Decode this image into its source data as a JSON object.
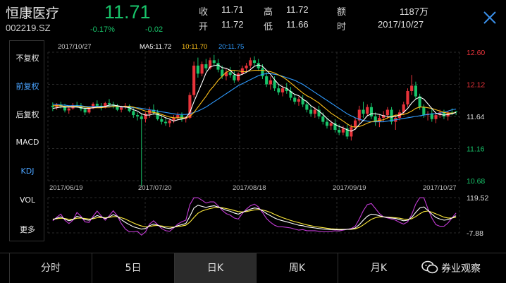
{
  "stock": {
    "name": "恒康医疗",
    "code": "002219.SZ",
    "price": "11.71",
    "change_pct": "-0.17%",
    "change_abs": "-0.02"
  },
  "quote": {
    "close_label": "收",
    "close_value": "11.71",
    "open_label": "开",
    "open_value": "11.72",
    "high_label": "高",
    "high_value": "11.72",
    "low_label": "低",
    "low_value": "11.66",
    "amount_label": "额",
    "amount_value": "1187万",
    "time_label": "时",
    "time_value": "2017/10/27"
  },
  "sidebar": {
    "items": [
      {
        "label": "不复权",
        "active": false
      },
      {
        "label": "前复权",
        "active": true
      },
      {
        "label": "后复权",
        "active": false
      },
      {
        "label": "MACD",
        "active": false
      },
      {
        "label": "KDJ",
        "active": true
      },
      {
        "label": "VOL",
        "active": false
      },
      {
        "label": "更多",
        "active": false
      }
    ]
  },
  "ma_legend": {
    "date": "2017/10/27",
    "ma5": "MA5:11.72",
    "ma10": "10:11.70",
    "ma20": "20:11.75"
  },
  "tabs": [
    {
      "label": "分时",
      "active": false
    },
    {
      "label": "5日",
      "active": false
    },
    {
      "label": "日K",
      "active": true
    },
    {
      "label": "周K",
      "active": false
    },
    {
      "label": "月K",
      "active": false
    }
  ],
  "watermark": {
    "text": "券业观察",
    "icon": "wechat-icon"
  },
  "colors": {
    "up": "#e8333a",
    "down": "#18c46a",
    "ma5": "#ffffff",
    "ma10": "#ffc21a",
    "ma20": "#2f9bff",
    "k_line": "#ffffff",
    "d_line": "#ffeb3b",
    "j_line": "#c43bd6",
    "accent": "#4aa3ff"
  },
  "chart_data": {
    "type": "candlestick",
    "price_axis": {
      "labels": [
        "12.60",
        "12.12",
        "11.64",
        "11.16",
        "10.68"
      ],
      "values": [
        12.6,
        12.12,
        11.64,
        11.16,
        10.68
      ],
      "label_colors": [
        "#e8333a",
        "#e8333a",
        "#dddddd",
        "#18c46a",
        "#18c46a"
      ]
    },
    "x_ticks": [
      "2017/06/19",
      "2017/07/20",
      "2017/08/18",
      "2017/09/19",
      "2017/10/27"
    ],
    "indicator_axis": {
      "labels": [
        "119.52",
        "-7.88"
      ],
      "values": [
        119.52,
        -7.88
      ]
    },
    "ohlc": [
      [
        11.8,
        11.85,
        11.72,
        11.78
      ],
      [
        11.78,
        11.84,
        11.74,
        11.82
      ],
      [
        11.82,
        11.86,
        11.76,
        11.79
      ],
      [
        11.79,
        11.83,
        11.7,
        11.73
      ],
      [
        11.73,
        11.8,
        11.68,
        11.76
      ],
      [
        11.76,
        11.84,
        11.74,
        11.81
      ],
      [
        11.81,
        11.86,
        11.77,
        11.8
      ],
      [
        11.8,
        11.84,
        11.72,
        11.75
      ],
      [
        11.75,
        11.79,
        11.66,
        11.7
      ],
      [
        11.7,
        11.78,
        11.68,
        11.76
      ],
      [
        11.76,
        11.85,
        11.75,
        11.83
      ],
      [
        11.83,
        11.88,
        11.78,
        11.8
      ],
      [
        11.8,
        11.84,
        11.73,
        11.77
      ],
      [
        11.77,
        11.86,
        11.76,
        11.84
      ],
      [
        11.84,
        11.9,
        11.79,
        11.82
      ],
      [
        11.82,
        11.86,
        11.76,
        11.8
      ],
      [
        11.8,
        11.83,
        11.72,
        11.74
      ],
      [
        11.74,
        11.8,
        11.7,
        11.78
      ],
      [
        11.78,
        11.84,
        11.75,
        11.8
      ],
      [
        11.8,
        11.82,
        11.7,
        11.72
      ],
      [
        11.72,
        11.76,
        11.62,
        11.66
      ],
      [
        11.66,
        11.7,
        11.58,
        11.64
      ],
      [
        11.64,
        11.68,
        10.6,
        11.6
      ],
      [
        11.6,
        11.7,
        11.55,
        11.68
      ],
      [
        11.68,
        11.78,
        11.62,
        11.74
      ],
      [
        11.74,
        11.82,
        11.66,
        11.7
      ],
      [
        11.7,
        11.74,
        11.58,
        11.6
      ],
      [
        11.6,
        11.66,
        11.52,
        11.56
      ],
      [
        11.56,
        11.62,
        11.5,
        11.54
      ],
      [
        11.54,
        11.6,
        11.48,
        11.58
      ],
      [
        11.58,
        11.66,
        11.54,
        11.62
      ],
      [
        11.62,
        11.7,
        11.58,
        11.66
      ],
      [
        11.66,
        11.7,
        11.56,
        11.6
      ],
      [
        11.6,
        11.64,
        11.55,
        11.62
      ],
      [
        11.62,
        12.0,
        11.6,
        11.96
      ],
      [
        11.96,
        12.46,
        11.92,
        12.4
      ],
      [
        12.4,
        12.52,
        12.22,
        12.28
      ],
      [
        12.28,
        12.46,
        12.24,
        12.42
      ],
      [
        12.42,
        12.5,
        12.32,
        12.36
      ],
      [
        12.36,
        12.52,
        12.34,
        12.48
      ],
      [
        12.48,
        12.56,
        12.4,
        12.44
      ],
      [
        12.44,
        12.5,
        12.3,
        12.34
      ],
      [
        12.34,
        12.4,
        12.2,
        12.24
      ],
      [
        12.24,
        12.36,
        12.18,
        12.3
      ],
      [
        12.3,
        12.38,
        12.22,
        12.26
      ],
      [
        12.26,
        12.32,
        12.14,
        12.18
      ],
      [
        12.18,
        12.3,
        12.16,
        12.28
      ],
      [
        12.28,
        12.4,
        12.26,
        12.36
      ],
      [
        12.36,
        12.44,
        12.3,
        12.4
      ],
      [
        12.4,
        12.52,
        12.36,
        12.48
      ],
      [
        12.48,
        12.54,
        12.4,
        12.44
      ],
      [
        12.44,
        12.5,
        12.32,
        12.36
      ],
      [
        12.36,
        12.42,
        12.2,
        12.24
      ],
      [
        12.24,
        12.3,
        12.08,
        12.12
      ],
      [
        12.12,
        12.24,
        12.04,
        12.18
      ],
      [
        12.18,
        12.24,
        12.02,
        12.06
      ],
      [
        12.06,
        12.12,
        11.96,
        12.0
      ],
      [
        12.0,
        12.1,
        11.94,
        12.06
      ],
      [
        12.06,
        12.14,
        11.98,
        12.02
      ],
      [
        12.02,
        12.08,
        11.88,
        11.92
      ],
      [
        11.92,
        11.98,
        11.82,
        11.86
      ],
      [
        11.86,
        11.94,
        11.8,
        11.9
      ],
      [
        11.9,
        11.96,
        11.78,
        11.82
      ],
      [
        11.82,
        11.88,
        11.7,
        11.74
      ],
      [
        11.74,
        11.8,
        11.64,
        11.68
      ],
      [
        11.68,
        11.78,
        11.62,
        11.74
      ],
      [
        11.74,
        11.8,
        11.6,
        11.64
      ],
      [
        11.64,
        11.7,
        11.52,
        11.56
      ],
      [
        11.56,
        11.62,
        11.46,
        11.5
      ],
      [
        11.5,
        11.58,
        11.44,
        11.54
      ],
      [
        11.54,
        11.6,
        11.4,
        11.44
      ],
      [
        11.44,
        11.52,
        11.36,
        11.4
      ],
      [
        11.4,
        11.5,
        11.36,
        11.46
      ],
      [
        11.46,
        11.52,
        11.3,
        11.34
      ],
      [
        11.34,
        11.52,
        11.28,
        11.48
      ],
      [
        11.48,
        11.62,
        11.44,
        11.58
      ],
      [
        11.58,
        11.8,
        11.54,
        11.74
      ],
      [
        11.74,
        11.86,
        11.62,
        11.68
      ],
      [
        11.68,
        11.82,
        11.64,
        11.78
      ],
      [
        11.78,
        11.84,
        11.6,
        11.64
      ],
      [
        11.64,
        11.7,
        11.5,
        11.56
      ],
      [
        11.56,
        11.66,
        11.48,
        11.62
      ],
      [
        11.62,
        11.72,
        11.56,
        11.66
      ],
      [
        11.66,
        11.78,
        11.6,
        11.74
      ],
      [
        11.74,
        11.78,
        11.52,
        11.56
      ],
      [
        11.56,
        11.66,
        11.44,
        11.62
      ],
      [
        11.62,
        11.74,
        11.58,
        11.7
      ],
      [
        11.7,
        11.86,
        11.66,
        11.82
      ],
      [
        11.82,
        12.06,
        11.78,
        12.02
      ],
      [
        12.02,
        12.26,
        11.96,
        12.1
      ],
      [
        12.1,
        12.16,
        11.9,
        11.94
      ],
      [
        11.94,
        11.98,
        11.74,
        11.78
      ],
      [
        11.78,
        11.82,
        11.62,
        11.66
      ],
      [
        11.66,
        11.72,
        11.58,
        11.68
      ],
      [
        11.68,
        11.76,
        11.56,
        11.6
      ],
      [
        11.6,
        11.7,
        11.54,
        11.66
      ],
      [
        11.66,
        11.74,
        11.62,
        11.7
      ],
      [
        11.7,
        11.74,
        11.6,
        11.64
      ],
      [
        11.64,
        11.72,
        11.58,
        11.7
      ],
      [
        11.7,
        11.76,
        11.66,
        11.68
      ],
      [
        11.72,
        11.72,
        11.66,
        11.71
      ]
    ],
    "ma5": [
      11.76,
      11.77,
      11.78,
      11.78,
      11.78,
      11.78,
      11.78,
      11.77,
      11.76,
      11.76,
      11.77,
      11.78,
      11.78,
      11.79,
      11.81,
      11.81,
      11.8,
      11.79,
      11.78,
      11.77,
      11.74,
      11.72,
      11.68,
      11.66,
      11.66,
      11.68,
      11.67,
      11.65,
      11.62,
      11.6,
      11.57,
      11.59,
      11.6,
      11.62,
      11.7,
      11.86,
      12.0,
      12.14,
      12.29,
      12.38,
      12.4,
      12.41,
      12.37,
      12.36,
      12.33,
      12.27,
      12.25,
      12.27,
      12.3,
      12.34,
      12.39,
      12.41,
      12.39,
      12.33,
      12.27,
      12.19,
      12.12,
      12.08,
      12.06,
      12.01,
      11.97,
      11.95,
      11.9,
      11.86,
      11.8,
      11.76,
      11.72,
      11.67,
      11.61,
      11.56,
      11.52,
      11.49,
      11.47,
      11.44,
      11.42,
      11.45,
      11.52,
      11.58,
      11.65,
      11.68,
      11.68,
      11.67,
      11.65,
      11.64,
      11.63,
      11.64,
      11.66,
      11.7,
      11.76,
      11.84,
      11.9,
      11.93,
      11.9,
      11.83,
      11.76,
      11.69,
      11.67,
      11.66,
      11.67,
      11.68,
      11.7
    ],
    "ma10": [
      11.8,
      11.8,
      11.8,
      11.79,
      11.79,
      11.79,
      11.79,
      11.79,
      11.78,
      11.77,
      11.77,
      11.77,
      11.77,
      11.78,
      11.78,
      11.79,
      11.79,
      11.79,
      11.79,
      11.79,
      11.78,
      11.76,
      11.74,
      11.72,
      11.71,
      11.7,
      11.69,
      11.67,
      11.65,
      11.63,
      11.62,
      11.62,
      11.62,
      11.62,
      11.64,
      11.7,
      11.78,
      11.86,
      11.94,
      12.03,
      12.1,
      12.18,
      12.24,
      12.3,
      12.33,
      12.33,
      12.32,
      12.31,
      12.31,
      12.32,
      12.33,
      12.33,
      12.33,
      12.32,
      12.31,
      12.29,
      12.26,
      12.23,
      12.19,
      12.14,
      12.09,
      12.04,
      11.99,
      11.95,
      11.92,
      11.88,
      11.84,
      11.79,
      11.74,
      11.69,
      11.65,
      11.61,
      11.57,
      11.53,
      11.49,
      11.48,
      11.49,
      11.51,
      11.54,
      11.56,
      11.57,
      11.58,
      11.59,
      11.62,
      11.64,
      11.66,
      11.66,
      11.67,
      11.69,
      11.72,
      11.76,
      11.78,
      11.78,
      11.77,
      11.76,
      11.74,
      11.72,
      11.7,
      11.69,
      11.69,
      11.7
    ],
    "ma20": [
      11.82,
      11.82,
      11.81,
      11.81,
      11.8,
      11.8,
      11.8,
      11.8,
      11.79,
      11.79,
      11.79,
      11.79,
      11.79,
      11.79,
      11.79,
      11.79,
      11.79,
      11.78,
      11.78,
      11.78,
      11.77,
      11.77,
      11.76,
      11.75,
      11.74,
      11.73,
      11.72,
      11.71,
      11.7,
      11.69,
      11.68,
      11.67,
      11.67,
      11.67,
      11.68,
      11.7,
      11.72,
      11.75,
      11.78,
      11.82,
      11.86,
      11.9,
      11.94,
      11.98,
      12.02,
      12.06,
      12.1,
      12.13,
      12.16,
      12.19,
      12.22,
      12.25,
      12.27,
      12.28,
      12.28,
      12.27,
      12.26,
      12.24,
      12.22,
      12.2,
      12.18,
      12.15,
      12.12,
      12.08,
      12.04,
      12.0,
      11.96,
      11.92,
      11.88,
      11.84,
      11.8,
      11.76,
      11.72,
      11.68,
      11.65,
      11.62,
      11.6,
      11.58,
      11.57,
      11.56,
      11.56,
      11.56,
      11.56,
      11.57,
      11.58,
      11.59,
      11.6,
      11.61,
      11.62,
      11.63,
      11.64,
      11.65,
      11.66,
      11.67,
      11.68,
      11.68,
      11.69,
      11.7,
      11.72,
      11.74,
      11.75
    ],
    "kdj": {
      "k": [
        40,
        45,
        50,
        42,
        36,
        40,
        52,
        48,
        40,
        38,
        46,
        55,
        50,
        44,
        50,
        58,
        52,
        40,
        30,
        22,
        14,
        10,
        6,
        8,
        18,
        24,
        20,
        14,
        10,
        8,
        12,
        18,
        22,
        26,
        52,
        82,
        92,
        88,
        84,
        88,
        90,
        86,
        80,
        74,
        70,
        64,
        60,
        66,
        72,
        78,
        82,
        80,
        72,
        62,
        54,
        46,
        40,
        36,
        32,
        28,
        24,
        20,
        18,
        14,
        12,
        10,
        8,
        6,
        5,
        4,
        4,
        3,
        4,
        5,
        6,
        10,
        22,
        38,
        52,
        60,
        58,
        54,
        50,
        48,
        46,
        44,
        40,
        36,
        38,
        48,
        66,
        82,
        86,
        74,
        60,
        48,
        42,
        38,
        40,
        46,
        54
      ],
      "d": [
        42,
        43,
        45,
        44,
        41,
        41,
        45,
        46,
        44,
        42,
        43,
        47,
        48,
        47,
        48,
        51,
        51,
        47,
        42,
        35,
        28,
        22,
        17,
        14,
        15,
        18,
        19,
        17,
        15,
        13,
        13,
        15,
        17,
        20,
        31,
        48,
        63,
        71,
        76,
        80,
        83,
        84,
        83,
        80,
        77,
        73,
        69,
        68,
        69,
        72,
        75,
        77,
        75,
        71,
        66,
        59,
        53,
        47,
        42,
        37,
        33,
        29,
        25,
        21,
        18,
        15,
        13,
        11,
        9,
        7,
        6,
        5,
        5,
        5,
        5,
        7,
        12,
        21,
        31,
        41,
        47,
        50,
        50,
        49,
        48,
        47,
        45,
        42,
        41,
        43,
        51,
        61,
        69,
        71,
        67,
        61,
        55,
        49,
        46,
        46,
        49
      ],
      "j": [
        36,
        49,
        60,
        38,
        26,
        38,
        66,
        52,
        32,
        30,
        52,
        71,
        54,
        38,
        54,
        72,
        54,
        26,
        6,
        -4,
        -4,
        -2,
        -16,
        -4,
        24,
        36,
        22,
        8,
        0,
        -2,
        10,
        24,
        32,
        38,
        94,
        119,
        119,
        110,
        100,
        104,
        104,
        90,
        74,
        62,
        56,
        46,
        42,
        62,
        78,
        90,
        96,
        86,
        66,
        44,
        30,
        20,
        14,
        14,
        12,
        10,
        6,
        2,
        4,
        0,
        0,
        0,
        -2,
        -4,
        -4,
        -2,
        0,
        -1,
        2,
        5,
        8,
        16,
        42,
        72,
        94,
        98,
        80,
        62,
        50,
        46,
        42,
        38,
        30,
        24,
        32,
        58,
        96,
        119,
        119,
        80,
        46,
        22,
        16,
        16,
        28,
        46,
        64
      ]
    }
  }
}
